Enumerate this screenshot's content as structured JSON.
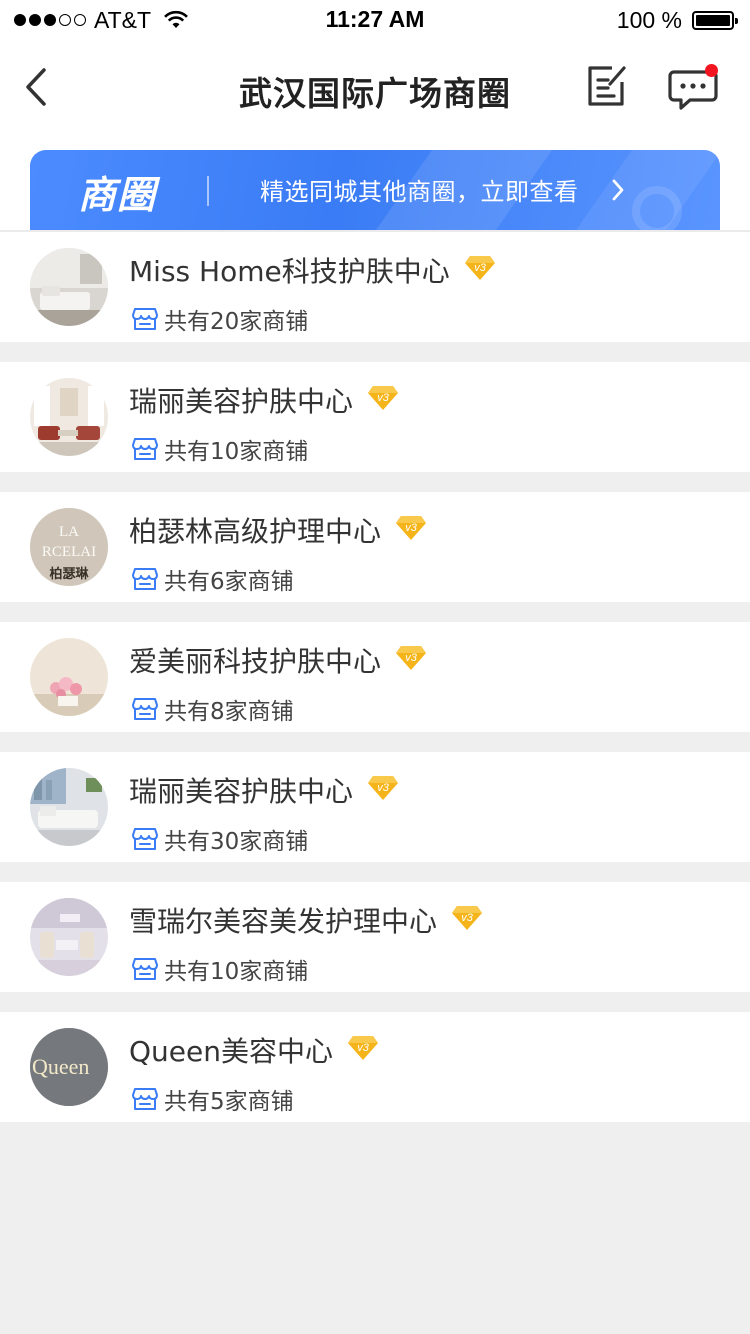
{
  "status_bar": {
    "carrier": "AT&T",
    "time": "11:27 AM",
    "battery": "100 %"
  },
  "nav": {
    "title": "武汉国际广场商圈"
  },
  "banner": {
    "logo": "商圈",
    "text": "精选同城其他商圈，立即查看"
  },
  "colors": {
    "accent_blue": "#3a7cf5",
    "badge_gold": "#f5b51a",
    "notify_red": "#f2141e"
  },
  "items": [
    {
      "name": "Miss Home科技护肤中心",
      "badge": "v3",
      "stores": "共有20家商铺"
    },
    {
      "name": "瑞丽美容护肤中心",
      "badge": "v3",
      "stores": "共有10家商铺"
    },
    {
      "name": "柏瑟林高级护理中心",
      "badge": "v3",
      "stores": "共有6家商铺",
      "avatar_text_1": "LA",
      "avatar_text_2": "RCELAI",
      "avatar_text_3": "柏瑟琳"
    },
    {
      "name": "爱美丽科技护肤中心",
      "badge": "v3",
      "stores": "共有8家商铺"
    },
    {
      "name": "瑞丽美容护肤中心",
      "badge": "v3",
      "stores": "共有30家商铺"
    },
    {
      "name": "雪瑞尔美容美发护理中心",
      "badge": "v3",
      "stores": "共有10家商铺"
    },
    {
      "name": "Queen美容中心",
      "badge": "v3",
      "stores": "共有5家商铺",
      "avatar_text_1": "Queen"
    }
  ]
}
